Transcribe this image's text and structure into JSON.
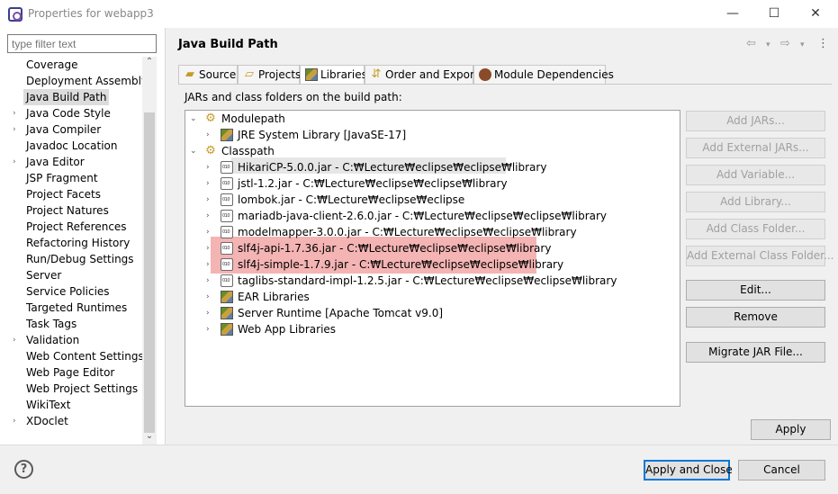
{
  "window": {
    "title": "Properties for webapp3"
  },
  "filter": {
    "placeholder": "type filter text"
  },
  "left_tree": [
    {
      "label": "Coverage",
      "arrow": ""
    },
    {
      "label": "Deployment Assembly",
      "arrow": ""
    },
    {
      "label": "Java Build Path",
      "arrow": "",
      "selected": true
    },
    {
      "label": "Java Code Style",
      "arrow": "›"
    },
    {
      "label": "Java Compiler",
      "arrow": "›"
    },
    {
      "label": "Javadoc Location",
      "arrow": ""
    },
    {
      "label": "Java Editor",
      "arrow": "›"
    },
    {
      "label": "JSP Fragment",
      "arrow": ""
    },
    {
      "label": "Project Facets",
      "arrow": ""
    },
    {
      "label": "Project Natures",
      "arrow": ""
    },
    {
      "label": "Project References",
      "arrow": ""
    },
    {
      "label": "Refactoring History",
      "arrow": ""
    },
    {
      "label": "Run/Debug Settings",
      "arrow": ""
    },
    {
      "label": "Server",
      "arrow": ""
    },
    {
      "label": "Service Policies",
      "arrow": ""
    },
    {
      "label": "Targeted Runtimes",
      "arrow": ""
    },
    {
      "label": "Task Tags",
      "arrow": ""
    },
    {
      "label": "Validation",
      "arrow": "›"
    },
    {
      "label": "Web Content Settings",
      "arrow": ""
    },
    {
      "label": "Web Page Editor",
      "arrow": ""
    },
    {
      "label": "Web Project Settings",
      "arrow": ""
    },
    {
      "label": "WikiText",
      "arrow": ""
    },
    {
      "label": "XDoclet",
      "arrow": "›"
    }
  ],
  "page": {
    "title": "Java Build Path",
    "section_label": "JARs and class folders on the build path:"
  },
  "tabs": [
    {
      "label": "Source"
    },
    {
      "label": "Projects"
    },
    {
      "label": "Libraries"
    },
    {
      "label": "Order and Export"
    },
    {
      "label": "Module Dependencies"
    }
  ],
  "build_tree": [
    {
      "label": "Modulepath",
      "level": 0,
      "twisty": "⌄",
      "icon": "modulepath-icon"
    },
    {
      "label": "JRE System Library [JavaSE-17]",
      "level": 1,
      "twisty": "›",
      "icon": "library-icon"
    },
    {
      "label": "Classpath",
      "level": 0,
      "twisty": "⌄",
      "icon": "classpath-icon"
    },
    {
      "label": "HikariCP-5.0.0.jar - C:₩Lecture₩eclipse₩eclipse₩library",
      "level": 1,
      "twisty": "›",
      "icon": "jar-icon"
    },
    {
      "label": "jstl-1.2.jar - C:₩Lecture₩eclipse₩eclipse₩library",
      "level": 1,
      "twisty": "›",
      "icon": "jar-icon"
    },
    {
      "label": "lombok.jar - C:₩Lecture₩eclipse₩eclipse",
      "level": 1,
      "twisty": "›",
      "icon": "jar-icon"
    },
    {
      "label": "mariadb-java-client-2.6.0.jar - C:₩Lecture₩eclipse₩eclipse₩library",
      "level": 1,
      "twisty": "›",
      "icon": "jar-icon"
    },
    {
      "label": "modelmapper-3.0.0.jar - C:₩Lecture₩eclipse₩eclipse₩library",
      "level": 1,
      "twisty": "›",
      "icon": "jar-icon"
    },
    {
      "label": "slf4j-api-1.7.36.jar - C:₩Lecture₩eclipse₩eclipse₩library",
      "level": 1,
      "twisty": "›",
      "icon": "jar-icon"
    },
    {
      "label": "slf4j-simple-1.7.9.jar - C:₩Lecture₩eclipse₩eclipse₩library",
      "level": 1,
      "twisty": "›",
      "icon": "jar-icon"
    },
    {
      "label": "taglibs-standard-impl-1.2.5.jar - C:₩Lecture₩eclipse₩eclipse₩library",
      "level": 1,
      "twisty": "›",
      "icon": "jar-icon"
    },
    {
      "label": "EAR Libraries",
      "level": 1,
      "twisty": "›",
      "icon": "library-icon"
    },
    {
      "label": "Server Runtime [Apache Tomcat v9.0]",
      "level": 1,
      "twisty": "›",
      "icon": "library-icon"
    },
    {
      "label": "Web App Libraries",
      "level": 1,
      "twisty": "›",
      "icon": "library-icon"
    }
  ],
  "side_buttons": [
    {
      "label": "Add JARs...",
      "enabled": false
    },
    {
      "label": "Add External JARs...",
      "enabled": false
    },
    {
      "label": "Add Variable...",
      "enabled": false
    },
    {
      "label": "Add Library...",
      "enabled": false
    },
    {
      "label": "Add Class Folder...",
      "enabled": false
    },
    {
      "label": "Add External Class Folder...",
      "enabled": false
    },
    {
      "label": "Edit...",
      "enabled": true
    },
    {
      "label": "Remove",
      "enabled": true
    },
    {
      "label": "Migrate JAR File...",
      "enabled": true
    }
  ],
  "apply_label": "Apply",
  "footer": {
    "apply_close": "Apply and Close",
    "cancel": "Cancel",
    "help": "?"
  }
}
